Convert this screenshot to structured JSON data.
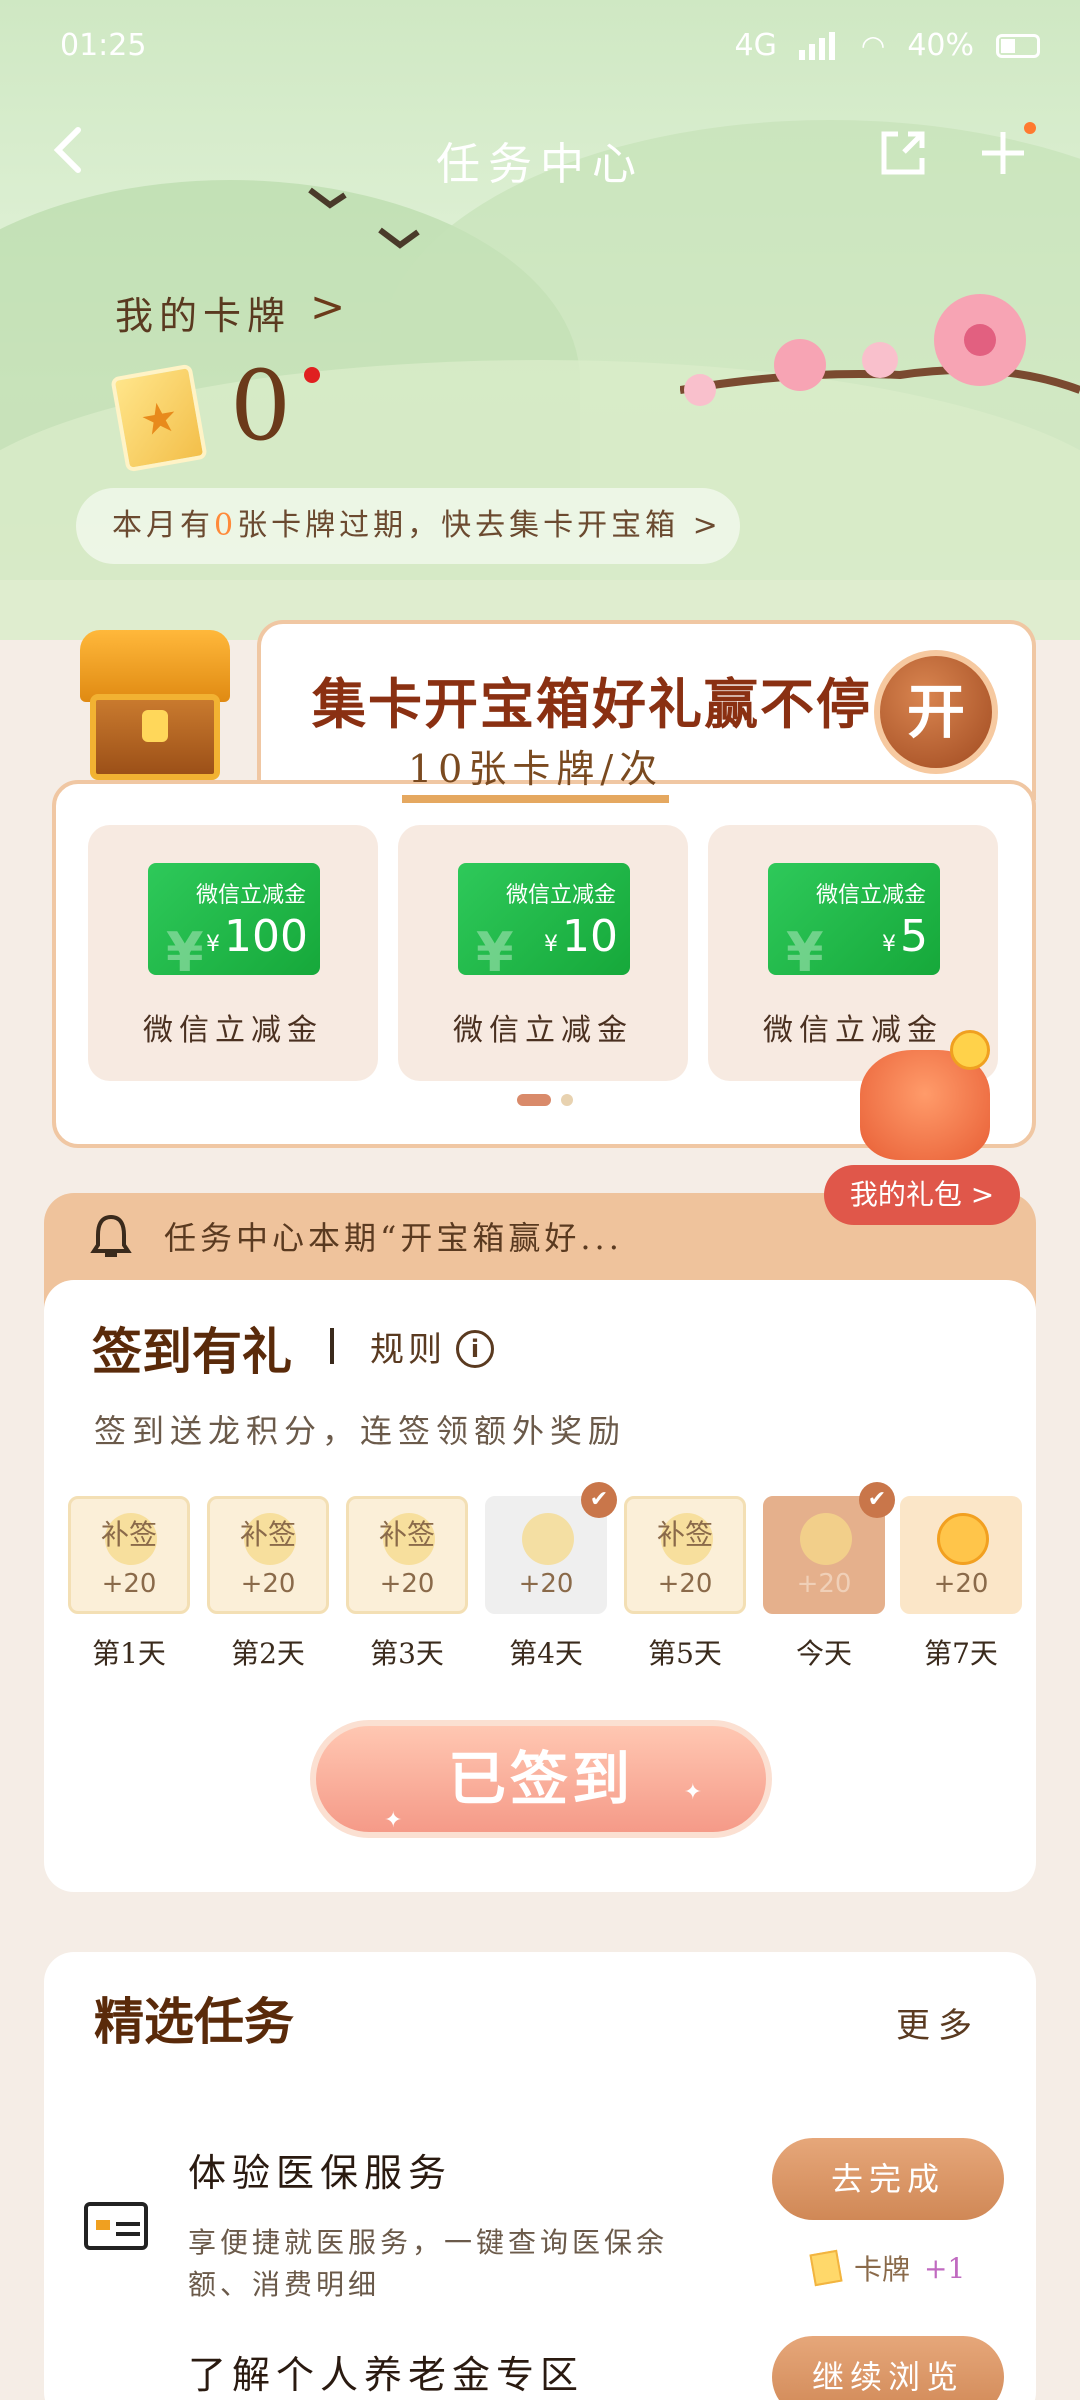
{
  "status": {
    "time": "01:25",
    "battery": "40%",
    "network": "4G"
  },
  "nav": {
    "title": "任务中心"
  },
  "my_cards": {
    "label": "我的卡牌",
    "arrow": ">",
    "count": "0"
  },
  "expire_notice": {
    "prefix": "本月有",
    "num": "0",
    "suffix": "张卡牌过期，快去集卡开宝箱 >"
  },
  "treasure": {
    "title": "集卡开宝箱好礼赢不停",
    "subtitle": "10张卡牌/次",
    "open_label": "开",
    "coupons": [
      {
        "tag": "微信立减金",
        "currency": "¥",
        "amount": "100",
        "label": "微信立减金"
      },
      {
        "tag": "微信立减金",
        "currency": "¥",
        "amount": "10",
        "label": "微信立减金"
      },
      {
        "tag": "微信立减金",
        "currency": "¥",
        "amount": "5",
        "label": "微信立减金"
      }
    ],
    "carousel": {
      "current": 1,
      "total": 2
    },
    "my_gift": "我的礼包 >"
  },
  "notice": {
    "text": "任务中心本期“开宝箱赢好..."
  },
  "signin": {
    "title": "签到有礼",
    "rules": "规则",
    "info_icon": "i",
    "desc": "签到送龙积分，连签领额外奖励",
    "days": [
      {
        "mark": "补签",
        "points": "+20",
        "label": "第1天"
      },
      {
        "mark": "补签",
        "points": "+20",
        "label": "第2天"
      },
      {
        "mark": "补签",
        "points": "+20",
        "label": "第3天"
      },
      {
        "mark": "",
        "points": "+20",
        "label": "第4天",
        "checked": true
      },
      {
        "mark": "补签",
        "points": "+20",
        "label": "第5天"
      },
      {
        "mark": "",
        "points": "+20",
        "label": "今天",
        "checked": true
      },
      {
        "mark": "",
        "points": "+20",
        "label": "第7天"
      }
    ],
    "check_mark": "✔",
    "button": "已签到"
  },
  "tasks": {
    "title": "精选任务",
    "more": "更多",
    "items": [
      {
        "title": "体验医保服务",
        "desc": "享便捷就医服务，一键查询医保余额、消费明细",
        "button": "去完成",
        "reward": "卡牌",
        "reward_plus": "+1"
      },
      {
        "title": "了解个人养老金专区",
        "desc": "",
        "button": "继续浏览",
        "reward": "",
        "reward_plus": ""
      }
    ]
  },
  "colors": {
    "accent": "#d08856",
    "brand_brown": "#8a3012",
    "coupon_green": "#16a83a"
  }
}
